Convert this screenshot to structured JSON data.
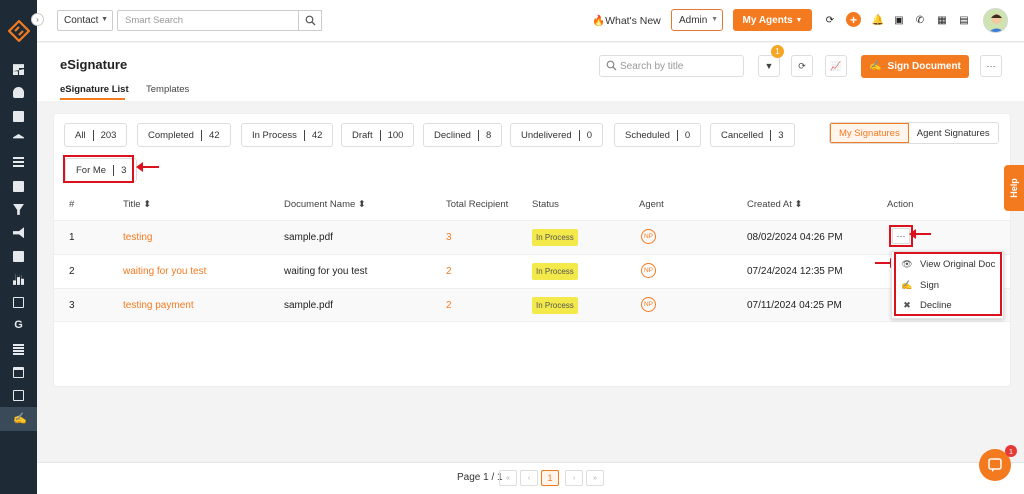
{
  "topbar": {
    "contact_select": "Contact",
    "smart_search_placeholder": "Smart Search",
    "whats_new": "What's New",
    "admin_select": "Admin",
    "my_agents": "My Agents"
  },
  "header": {
    "title": "eSignature",
    "tabs": [
      "eSignature List",
      "Templates"
    ],
    "search_placeholder": "Search by title",
    "filter_badge": "1",
    "sign_document": "Sign Document"
  },
  "filters": [
    {
      "label": "All",
      "count": "203"
    },
    {
      "label": "Completed",
      "count": "42"
    },
    {
      "label": "In Process",
      "count": "42"
    },
    {
      "label": "Draft",
      "count": "100"
    },
    {
      "label": "Declined",
      "count": "8"
    },
    {
      "label": "Undelivered",
      "count": "0"
    },
    {
      "label": "Scheduled",
      "count": "0"
    },
    {
      "label": "Cancelled",
      "count": "3"
    },
    {
      "label": "For Me",
      "count": "3"
    }
  ],
  "signature_toggle": {
    "mine": "My Signatures",
    "agent": "Agent Signatures"
  },
  "table": {
    "columns": [
      "#",
      "Title",
      "Document Name",
      "Total Recipient",
      "Status",
      "Agent",
      "Created At",
      "Action"
    ],
    "rows": [
      {
        "num": "1",
        "title": "testing",
        "doc": "sample.pdf",
        "recipients": "3",
        "status": "In Process",
        "agent": "NP",
        "created": "08/02/2024 04:26 PM"
      },
      {
        "num": "2",
        "title": "waiting for you test",
        "doc": "waiting for you test",
        "recipients": "2",
        "status": "In Process",
        "agent": "NP",
        "created": "07/24/2024 12:35 PM"
      },
      {
        "num": "3",
        "title": "testing payment",
        "doc": "sample.pdf",
        "recipients": "2",
        "status": "In Process",
        "agent": "NP",
        "created": "07/11/2024 04:25 PM"
      }
    ]
  },
  "action_menu": {
    "dots": "···",
    "items": [
      "View Original Doc",
      "Sign",
      "Decline"
    ]
  },
  "pagination": {
    "label": "Page 1 / 1",
    "current": "1",
    "first": "«",
    "prev": "‹",
    "next": "›",
    "last": "»"
  },
  "help": "Help",
  "chat_badge": "1",
  "colors": {
    "accent": "#f47a20",
    "sidebar": "#1e2b36",
    "status": "#f3e94a",
    "annotation": "#d9121e"
  }
}
